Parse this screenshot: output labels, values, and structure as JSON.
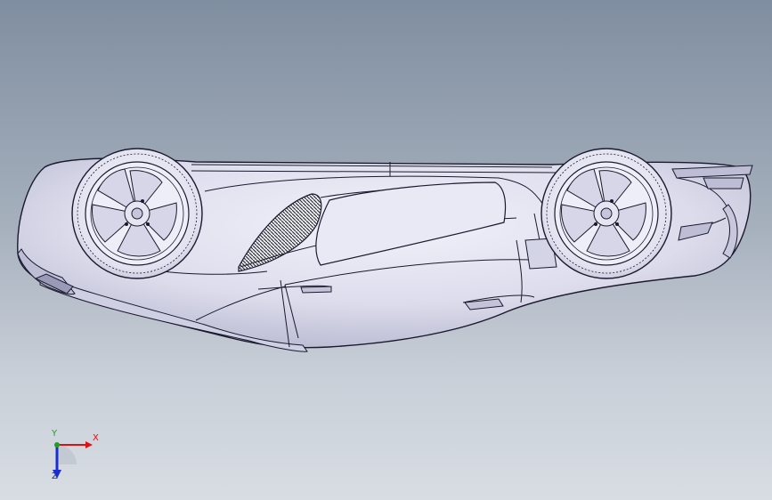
{
  "viewport": {
    "background_top": "#7f8ea0",
    "background_bottom": "#d8dde3"
  },
  "model": {
    "icon": "car-body-wireframe",
    "line_color": "#1a1a2e",
    "surface_color": "#e4e4f2"
  },
  "triad": {
    "x_label": "X",
    "y_label": "Y",
    "z_label": "Z",
    "x_color": "#e01010",
    "y_color": "#20a020",
    "z_color": "#1a2ed0"
  }
}
